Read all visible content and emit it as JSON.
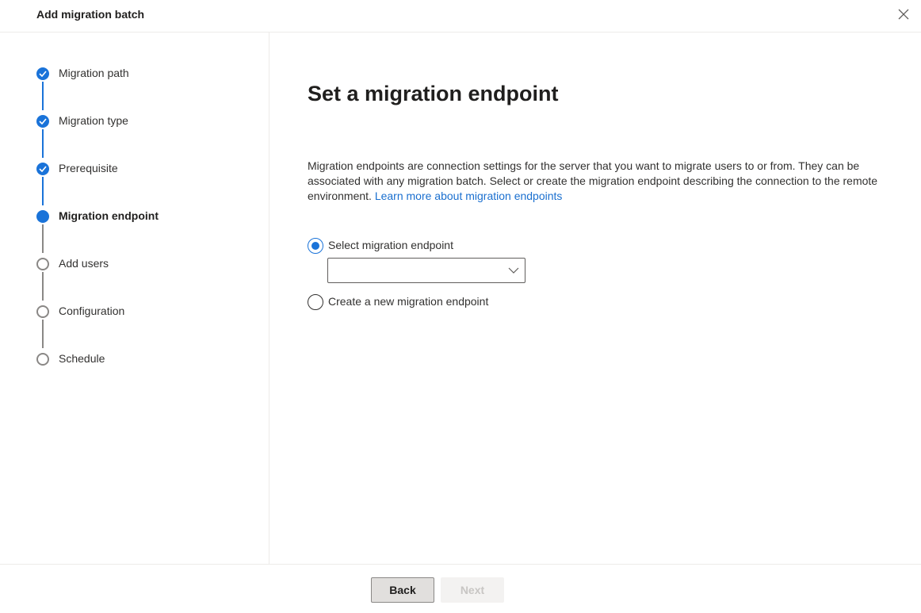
{
  "dialog": {
    "title": "Add migration batch",
    "close_icon": "close-icon"
  },
  "steps": [
    {
      "label": "Migration path",
      "status": "completed"
    },
    {
      "label": "Migration type",
      "status": "completed"
    },
    {
      "label": "Prerequisite",
      "status": "completed"
    },
    {
      "label": "Migration endpoint",
      "status": "current"
    },
    {
      "label": "Add users",
      "status": "pending"
    },
    {
      "label": "Configuration",
      "status": "pending"
    },
    {
      "label": "Schedule",
      "status": "pending"
    }
  ],
  "main": {
    "heading": "Set a migration endpoint",
    "description": "Migration endpoints are connection settings for the server that you want to migrate users to or from. They can be associated with any migration batch. Select or create the migration endpoint describing the connection to the remote environment.",
    "learn_more_link": "Learn more about migration endpoints",
    "options": [
      {
        "label": "Select migration endpoint",
        "selected": true
      },
      {
        "label": "Create a new migration endpoint",
        "selected": false
      }
    ],
    "endpoint_dropdown": {
      "value": "",
      "icon": "chevron-down-icon"
    }
  },
  "footer": {
    "back_label": "Back",
    "next_label": "Next",
    "next_enabled": false
  },
  "colors": {
    "accent": "#1a73d9",
    "pending_gray": "#8a8886",
    "link": "#1a6fcf"
  }
}
